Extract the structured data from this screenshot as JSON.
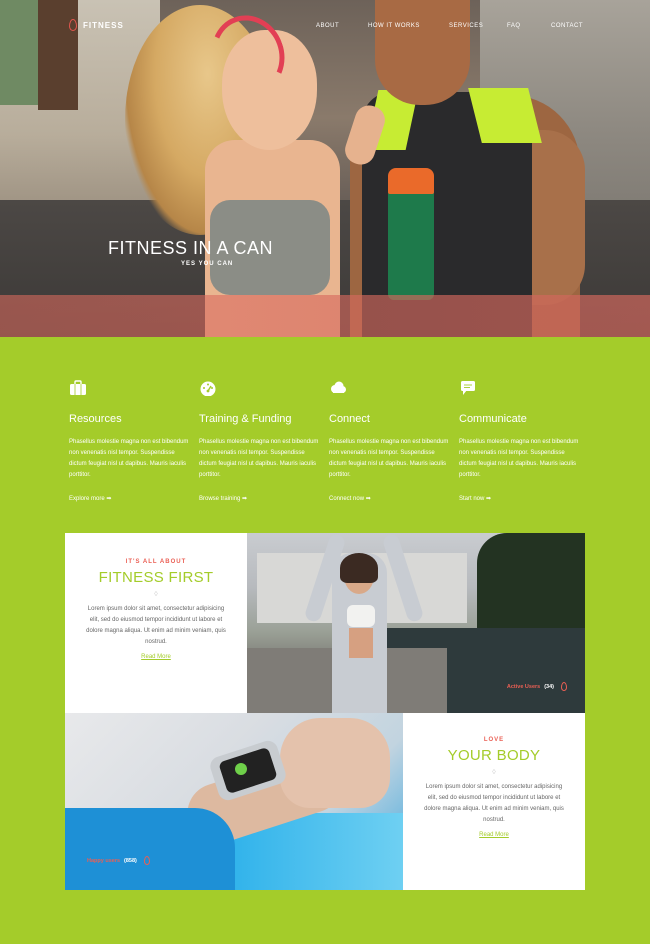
{
  "brand": {
    "name": "FITNESS"
  },
  "nav": {
    "items": [
      "ABOUT",
      "HOW IT WORKS",
      "SERVICES",
      "FAQ",
      "CONTACT"
    ]
  },
  "hero": {
    "title": "FITNESS IN A CAN",
    "subtitle": "YES YOU CAN"
  },
  "features": [
    {
      "title": "Resources",
      "icon": "briefcase-icon",
      "desc": "Phasellus molestie magna non est bibendum non venenatis nisl tempor. Suspendisse dictum feugiat nisl ut dapibus. Mauris iaculis porttitor.",
      "link": "Explore more"
    },
    {
      "title": "Training & Funding",
      "icon": "speedometer-icon",
      "desc": "Phasellus molestie magna non est bibendum non venenatis nisl tempor. Suspendisse dictum feugiat nisl ut dapibus. Mauris iaculis porttitor.",
      "link": "Browse training"
    },
    {
      "title": "Connect",
      "icon": "cloud-icon",
      "desc": "Phasellus molestie magna non est bibendum non venenatis nisl tempor. Suspendisse dictum feugiat nisl ut dapibus. Mauris iaculis porttitor.",
      "link": "Connect now"
    },
    {
      "title": "Communicate",
      "icon": "chat-icon",
      "desc": "Phasellus molestie magna non est bibendum non venenatis nisl tempor. Suspendisse dictum feugiat nisl ut dapibus. Mauris iaculis porttitor.",
      "link": "Start now"
    }
  ],
  "card1": {
    "eyebrow": "IT'S ALL ABOUT",
    "title": "FITNESS FIRST",
    "desc": "Lorem ipsum dolor sit amet, consectetur adipisicing elit, sed do eiusmod tempor incididunt ut labore et dolore magna aliqua. Ut enim ad minim veniam, quis nostrud.",
    "link": "Read More"
  },
  "card2": {
    "eyebrow": "LOVE",
    "title": "YOUR BODY",
    "desc": "Lorem ipsum dolor sit amet, consectetur adipisicing elit, sed do eiusmod tempor incididunt ut labore et dolore magna aliqua. Ut enim ad minim veniam, quis nostrud.",
    "link": "Read More"
  },
  "badge1": {
    "label": "Active Users",
    "count": "(34)"
  },
  "badge2": {
    "label": "Happy users",
    "count": "(858)"
  },
  "colors": {
    "accent": "#a4cc2a",
    "highlight": "#ea5f54"
  }
}
